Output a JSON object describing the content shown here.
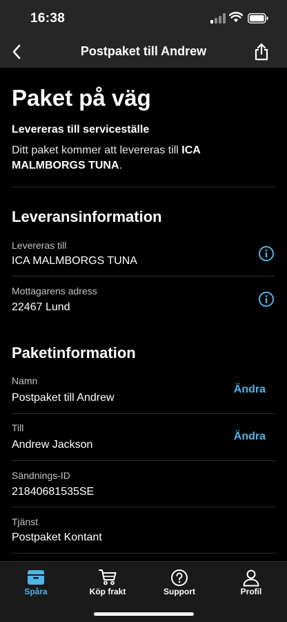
{
  "status_bar": {
    "time": "16:38"
  },
  "nav": {
    "title": "Postpaket till Andrew"
  },
  "hero": {
    "title": "Paket på väg",
    "subtitle": "Levereras till serviceställe",
    "text_prefix": "Ditt paket kommer att levereras till ",
    "text_bold": "ICA MALMBORGS TUNA",
    "text_suffix": "."
  },
  "delivery_info": {
    "title": "Leveransinformation",
    "rows": [
      {
        "label": "Levereras till",
        "value": "ICA MALMBORGS TUNA",
        "icon": "info-icon"
      },
      {
        "label": "Mottagarens adress",
        "value": "22467 Lund",
        "icon": "info-icon"
      }
    ]
  },
  "package_info": {
    "title": "Paketinformation",
    "rows": [
      {
        "label": "Namn",
        "value": "Postpaket till Andrew",
        "action": "Ändra"
      },
      {
        "label": "Till",
        "value": "Andrew Jackson",
        "action": "Ändra"
      },
      {
        "label": "Sändnings-ID",
        "value": "21840681535SE"
      },
      {
        "label": "Tjänst",
        "value": "Postpaket Kontant"
      }
    ]
  },
  "tabs": [
    {
      "label": "Spåra",
      "icon": "package-icon",
      "active": true
    },
    {
      "label": "Köp frakt",
      "icon": "cart-icon",
      "active": false
    },
    {
      "label": "Support",
      "icon": "question-icon",
      "active": false
    },
    {
      "label": "Profil",
      "icon": "person-icon",
      "active": false
    }
  ],
  "colors": {
    "accent": "#4fb4e6",
    "background": "#000000",
    "bar_background": "#262626",
    "tab_background": "#1a1a1a"
  }
}
